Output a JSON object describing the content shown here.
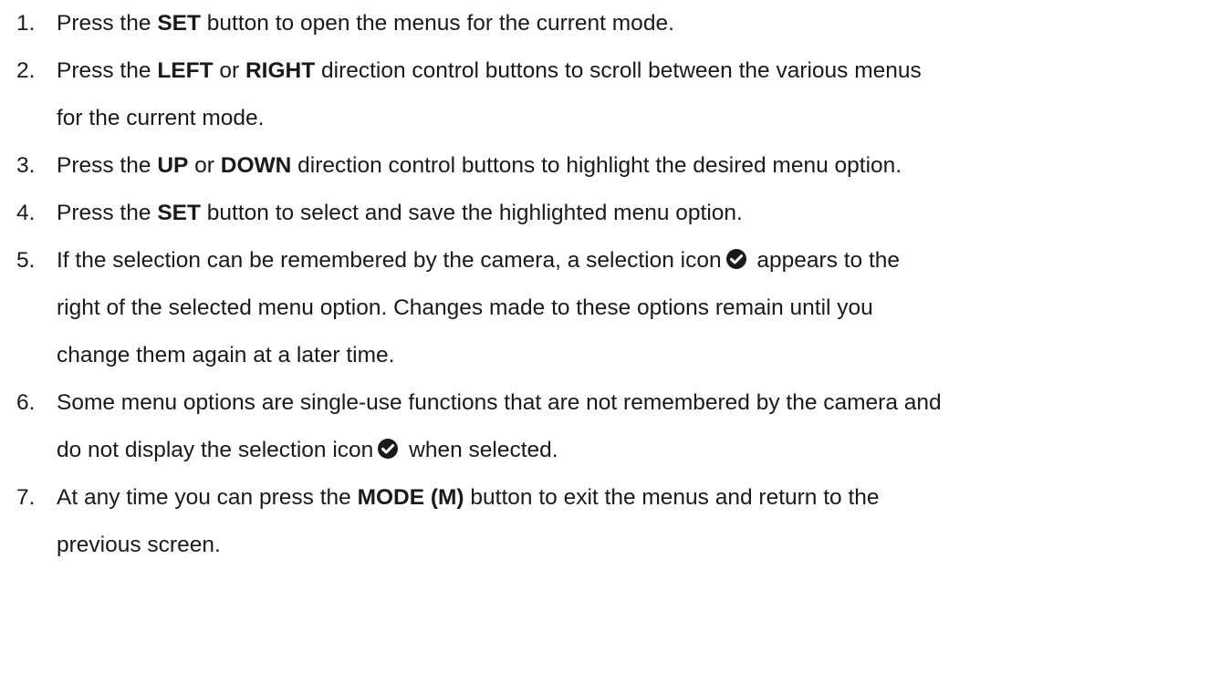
{
  "steps": [
    {
      "number": "1.",
      "lines": [
        [
          {
            "text": "Press the ",
            "bold": false
          },
          {
            "text": "SET",
            "bold": true
          },
          {
            "text": " button to open the menus for the current mode.",
            "bold": false
          }
        ]
      ]
    },
    {
      "number": "2.",
      "lines": [
        [
          {
            "text": "Press the ",
            "bold": false
          },
          {
            "text": "LEFT",
            "bold": true
          },
          {
            "text": " or ",
            "bold": false
          },
          {
            "text": "RIGHT",
            "bold": true
          },
          {
            "text": " direction control buttons to scroll between the various menus",
            "bold": false
          }
        ],
        [
          {
            "text": "for the current mode.",
            "bold": false
          }
        ]
      ]
    },
    {
      "number": "3.",
      "lines": [
        [
          {
            "text": "Press the ",
            "bold": false
          },
          {
            "text": "UP",
            "bold": true
          },
          {
            "text": " or ",
            "bold": false
          },
          {
            "text": "DOWN",
            "bold": true
          },
          {
            "text": " direction control buttons to highlight the desired menu option.",
            "bold": false
          }
        ]
      ]
    },
    {
      "number": "4.",
      "lines": [
        [
          {
            "text": "Press the ",
            "bold": false
          },
          {
            "text": "SET",
            "bold": true
          },
          {
            "text": " button to select and save the highlighted menu option.",
            "bold": false
          }
        ]
      ]
    },
    {
      "number": "5.",
      "lines": [
        [
          {
            "text": "If the selection can be remembered by the camera, a selection icon",
            "bold": false
          },
          {
            "icon": "selection-check-icon"
          },
          {
            "text": " appears to the",
            "bold": false
          }
        ],
        [
          {
            "text": "right of the selected menu option. Changes made to these options remain until you",
            "bold": false
          }
        ],
        [
          {
            "text": "change them again at a later time.",
            "bold": false
          }
        ]
      ]
    },
    {
      "number": "6.",
      "lines": [
        [
          {
            "text": "Some menu options are single-use functions that are not remembered by the camera and",
            "bold": false
          }
        ],
        [
          {
            "text": "do not display the selection icon",
            "bold": false
          },
          {
            "icon": "selection-check-icon"
          },
          {
            "text": " when selected.",
            "bold": false
          }
        ]
      ]
    },
    {
      "number": "7.",
      "lines": [
        [
          {
            "text": "At any time you can press the ",
            "bold": false
          },
          {
            "text": "MODE (M)",
            "bold": true
          },
          {
            "text": " button to exit the menus and return to the",
            "bold": false
          }
        ],
        [
          {
            "text": "previous screen.",
            "bold": false
          }
        ]
      ]
    }
  ],
  "colors": {
    "text": "#1a1a1a",
    "icon": "#1a1a1a",
    "background": "#ffffff"
  }
}
